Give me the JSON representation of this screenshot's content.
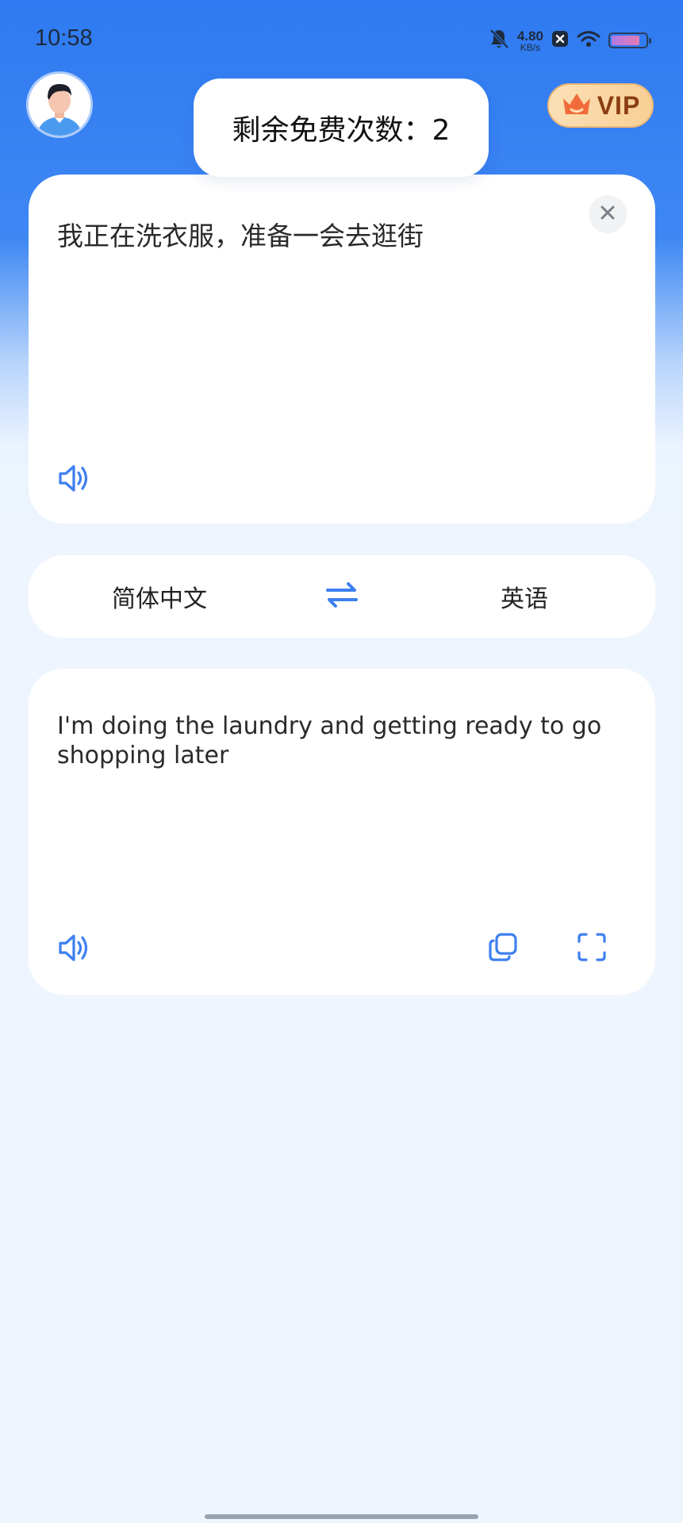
{
  "status_bar": {
    "time": "10:58",
    "net_speed_value": "4.80",
    "net_speed_unit": "KB/s",
    "icons": [
      "bell-muted-icon",
      "x-app-icon",
      "wifi-icon",
      "battery-icon"
    ],
    "battery_level": 0.85
  },
  "header": {
    "avatar_icon": "user-avatar-icon",
    "vip_label": "VIP",
    "vip_icon": "crown-icon"
  },
  "toast": {
    "text": "剩余免费次数：2"
  },
  "source_card": {
    "text": "我正在洗衣服，准备一会去逛街",
    "close_icon": "close-icon",
    "speaker_icon": "speaker-icon"
  },
  "language_bar": {
    "source_language": "简体中文",
    "target_language": "英语",
    "swap_icon": "swap-arrows-icon"
  },
  "result_card": {
    "text": "I'm doing the laundry and getting ready to go shopping later",
    "speaker_icon": "speaker-icon",
    "copy_icon": "copy-icon",
    "fullscreen_icon": "fullscreen-icon"
  },
  "colors": {
    "accent": "#3d7ff0",
    "header_blue": "#2f7af2",
    "background": "#eef5fe",
    "vip_text": "#8a3d12"
  }
}
